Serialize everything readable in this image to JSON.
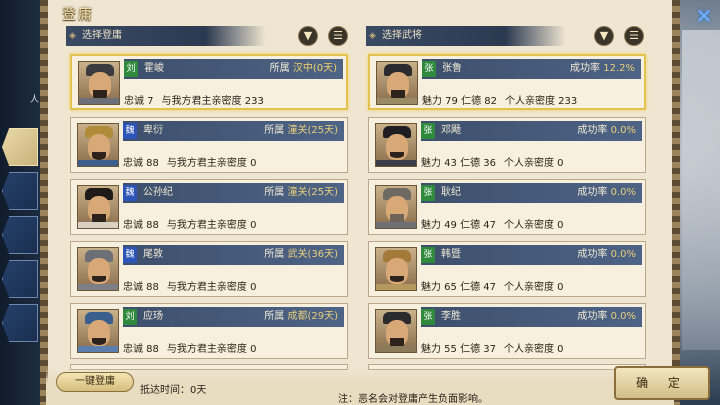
{
  "title": "登庸",
  "left_panel": {
    "label": "人"
  },
  "columns": {
    "left": {
      "header": "选择登庸"
    },
    "right": {
      "header": "选择武将"
    }
  },
  "icons": {
    "filter": "filter-icon",
    "list": "list-icon",
    "corner": "close-icon"
  },
  "officers_left": [
    {
      "faction": "刘",
      "faction_color": "#2f8a3e",
      "name": "霍峻",
      "belong_label": "所属",
      "location": "汉中(0天)",
      "stats": "忠诚 7",
      "intimacy": "与我方君主亲密度 233",
      "selected": true
    },
    {
      "faction": "魏",
      "faction_color": "#2d55b8",
      "name": "卑衍",
      "belong_label": "所属",
      "location": "潼关(25天)",
      "stats": "忠诚 88",
      "intimacy": "与我方君主亲密度 0",
      "selected": false
    },
    {
      "faction": "魏",
      "faction_color": "#2d55b8",
      "name": "公孙纪",
      "belong_label": "所属",
      "location": "潼关(25天)",
      "stats": "忠诚 88",
      "intimacy": "与我方君主亲密度 0",
      "selected": false
    },
    {
      "faction": "魏",
      "faction_color": "#2d55b8",
      "name": "尾敦",
      "belong_label": "所属",
      "location": "武关(36天)",
      "stats": "忠诚 88",
      "intimacy": "与我方君主亲密度 0",
      "selected": false
    },
    {
      "faction": "刘",
      "faction_color": "#2f8a3e",
      "name": "应玚",
      "belong_label": "所属",
      "location": "成都(29天)",
      "stats": "忠诚 88",
      "intimacy": "与我方君主亲密度 0",
      "selected": false
    }
  ],
  "officers_right": [
    {
      "faction": "张",
      "name": "张鲁",
      "rate_label": "成功率",
      "rate": "12.2%",
      "stats": "魅力 79  仁德 82",
      "intimacy": "个人亲密度 233",
      "selected": true
    },
    {
      "faction": "张",
      "name": "邓飏",
      "rate_label": "成功率",
      "rate": "0.0%",
      "stats": "魅力 43  仁德 36",
      "intimacy": "个人亲密度 0",
      "selected": false
    },
    {
      "faction": "张",
      "name": "耿纪",
      "rate_label": "成功率",
      "rate": "0.0%",
      "stats": "魅力 49  仁德 47",
      "intimacy": "个人亲密度 0",
      "selected": false
    },
    {
      "faction": "张",
      "name": "韩暨",
      "rate_label": "成功率",
      "rate": "0.0%",
      "stats": "魅力 65  仁德 47",
      "intimacy": "个人亲密度 0",
      "selected": false
    },
    {
      "faction": "张",
      "name": "李胜",
      "rate_label": "成功率",
      "rate": "0.0%",
      "stats": "魅力 55  仁德 37",
      "intimacy": "个人亲密度 0",
      "selected": false
    }
  ],
  "bottom": {
    "one_click_label": "一键登庸",
    "arrive_label": "抵达时间：0天",
    "note": "注：恶名会对登庸产生负面影响。",
    "confirm_label": "确 定"
  }
}
